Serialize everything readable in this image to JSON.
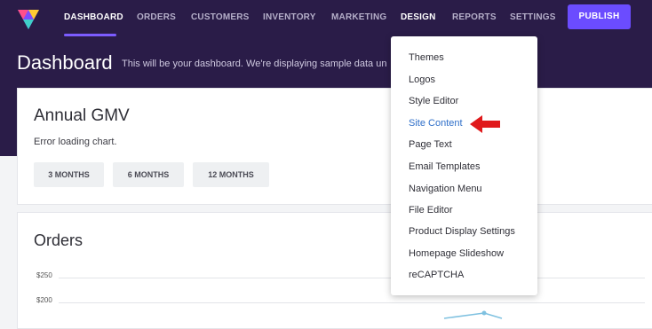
{
  "nav": {
    "items": [
      {
        "label": "Dashboard",
        "active": true
      },
      {
        "label": "Orders",
        "active": false
      },
      {
        "label": "Customers",
        "active": false
      },
      {
        "label": "Inventory",
        "active": false
      },
      {
        "label": "Marketing",
        "active": false
      },
      {
        "label": "Design",
        "active": false,
        "open": true
      },
      {
        "label": "Reports",
        "active": false
      },
      {
        "label": "Settings",
        "active": false
      }
    ],
    "publish_label": "Publish"
  },
  "header": {
    "title": "Dashboard",
    "subtitle": "This will be your dashboard. We're displaying sample data un"
  },
  "gmv_card": {
    "title": "Annual GMV",
    "error": "Error loading chart.",
    "ranges": [
      "3 Months",
      "6 Months",
      "12 Months"
    ]
  },
  "orders_card": {
    "title": "Orders",
    "y_ticks": [
      "$250",
      "$200"
    ]
  },
  "design_menu": {
    "items": [
      "Themes",
      "Logos",
      "Style Editor",
      "Site Content",
      "Page Text",
      "Email Templates",
      "Navigation Menu",
      "File Editor",
      "Product Display Settings",
      "Homepage Slideshow",
      "reCAPTCHA"
    ],
    "highlighted": "Site Content"
  },
  "colors": {
    "nav_bg": "#2a1c48",
    "accent": "#6b4cff",
    "link_blue": "#2f6fc9",
    "annotation_arrow": "#e0191b"
  }
}
